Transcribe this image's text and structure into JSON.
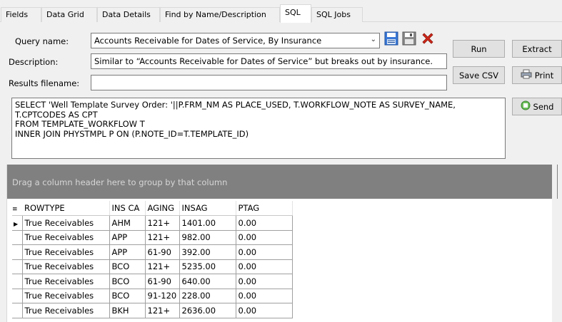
{
  "tabs": [
    {
      "label": "Fields"
    },
    {
      "label": "Data Grid"
    },
    {
      "label": "Data Details"
    },
    {
      "label": "Find by Name/Description"
    },
    {
      "label": "SQL"
    },
    {
      "label": "SQL Jobs"
    }
  ],
  "active_tab": "SQL",
  "form": {
    "query_name_label": "Query name:",
    "query_name_value": "Accounts Receivable for Dates of Service, By Insurance",
    "description_label": "Description:",
    "description_value": "Similar to “Accounts Receivable for Dates of Service” but breaks out by insurance.",
    "results_filename_label": "Results filename:",
    "results_filename_value": ""
  },
  "buttons": {
    "run": "Run",
    "extract": "Extract",
    "save_csv": "Save CSV",
    "print": "Print",
    "send": "Send"
  },
  "sql_text": "SELECT 'Well Template Survey Order: '||P.FRM_NM AS PLACE_USED, T.WORKFLOW_NOTE AS SURVEY_NAME,\nT.CPTCODES AS CPT\nFROM TEMPLATE_WORKFLOW T\nINNER JOIN PHYSTMPL P ON (P.NOTE_ID=T.TEMPLATE_ID)",
  "grid": {
    "group_hint": "Drag a column header here to group by that column",
    "columns": [
      "ROWTYPE",
      "INS CA",
      "AGING",
      "INSAG",
      "PTAG"
    ],
    "rows": [
      [
        "True Receivables",
        "AHM",
        "121+",
        "1401.00",
        "0.00"
      ],
      [
        "True Receivables",
        "APP",
        "121+",
        "982.00",
        "0.00"
      ],
      [
        "True Receivables",
        "APP",
        "61-90",
        "392.00",
        "0.00"
      ],
      [
        "True Receivables",
        "BCO",
        "121+",
        "5235.00",
        "0.00"
      ],
      [
        "True Receivables",
        "BCO",
        "61-90",
        "640.00",
        "0.00"
      ],
      [
        "True Receivables",
        "BCO",
        "91-120",
        "228.00",
        "0.00"
      ],
      [
        "True Receivables",
        "BKH",
        "121+",
        "2636.00",
        "0.00"
      ]
    ]
  },
  "colors": {
    "group_bar": "#808080",
    "delete_icon": "#d0281b",
    "save_icon": "#3a78d6"
  },
  "icons": [
    "save-icon",
    "save-as-icon",
    "delete-icon",
    "printer-icon",
    "send-icon",
    "chevron-down-icon",
    "row-pointer-icon",
    "column-chooser-icon"
  ]
}
